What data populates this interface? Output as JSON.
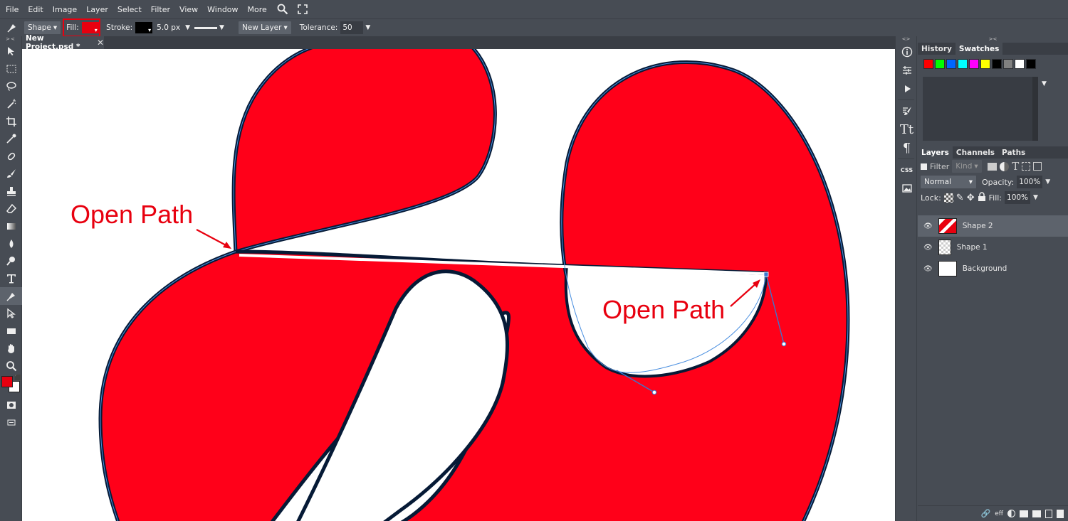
{
  "menu": [
    "File",
    "Edit",
    "Image",
    "Layer",
    "Select",
    "Filter",
    "View",
    "Window",
    "More"
  ],
  "options": {
    "mode": "Shape",
    "fill_label": "Fill:",
    "fill_color": "#e8000f",
    "stroke_label": "Stroke:",
    "stroke_color": "#000000",
    "stroke_width": "5.0 px",
    "layer_mode": "New Layer",
    "tolerance_label": "Tolerance:",
    "tolerance_value": "50"
  },
  "document": {
    "tab_title": "New Project.psd *"
  },
  "annotations": {
    "left_label": "Open Path",
    "right_label": "Open Path"
  },
  "colors": {
    "shape_fill": "#ff0019",
    "annotation": "#e8000f",
    "path_handle": "#3a78d0"
  },
  "right_panel": {
    "tabs_top": [
      "History",
      "Swatches"
    ],
    "swatches": [
      "#ff0000",
      "#00ff00",
      "#0066ff",
      "#00ffff",
      "#ff00ff",
      "#ffff00",
      "#000000",
      "#808080",
      "#ffffff",
      "#000000"
    ],
    "tabs_layers": [
      "Layers",
      "Channels",
      "Paths"
    ],
    "filter_label": "Filter",
    "kind_label": "Kind",
    "blend_mode": "Normal",
    "opacity_label": "Opacity:",
    "opacity_value": "100%",
    "lock_label": "Lock:",
    "fill_label": "Fill:",
    "fill_value": "100%",
    "layers": [
      {
        "name": "Shape 2",
        "selected": true
      },
      {
        "name": "Shape 1",
        "selected": false
      },
      {
        "name": "Background",
        "selected": false
      }
    ],
    "bottom_eff": "eff"
  }
}
